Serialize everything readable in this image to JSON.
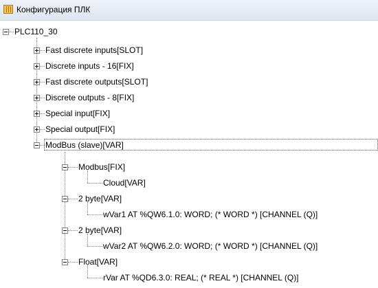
{
  "window": {
    "title": "Конфигурация ПЛК",
    "title_icon": "plc-config-icon"
  },
  "tree": {
    "root": "PLC110_30",
    "modules": [
      {
        "label": "Fast discrete inputs[SLOT]",
        "state": "collapsed"
      },
      {
        "label": "Discrete inputs - 16[FIX]",
        "state": "collapsed"
      },
      {
        "label": "Fast discrete outputs[SLOT]",
        "state": "collapsed"
      },
      {
        "label": "Discrete outputs - 8[FIX]",
        "state": "collapsed"
      },
      {
        "label": "Special input[FIX]",
        "state": "collapsed"
      },
      {
        "label": "Special output[FIX]",
        "state": "collapsed"
      },
      {
        "label": "ModBus (slave)[VAR]",
        "state": "expanded",
        "selected": true
      }
    ],
    "modbus_children": [
      {
        "label": "Modbus[FIX]",
        "state": "expanded",
        "child": "Cloud[VAR]"
      },
      {
        "label": "2 byte[VAR]",
        "state": "expanded",
        "child": "wVar1 AT %QW6.1.0: WORD; (* WORD *) [CHANNEL (Q)]"
      },
      {
        "label": "2 byte[VAR]",
        "state": "expanded",
        "child": "wVar2 AT %QW6.2.0: WORD; (* WORD *) [CHANNEL (Q)]"
      },
      {
        "label": "Float[VAR]",
        "state": "expanded",
        "child": "rVar AT %QD6.3.0: REAL; (* REAL *) [CHANNEL (Q)]"
      }
    ]
  }
}
